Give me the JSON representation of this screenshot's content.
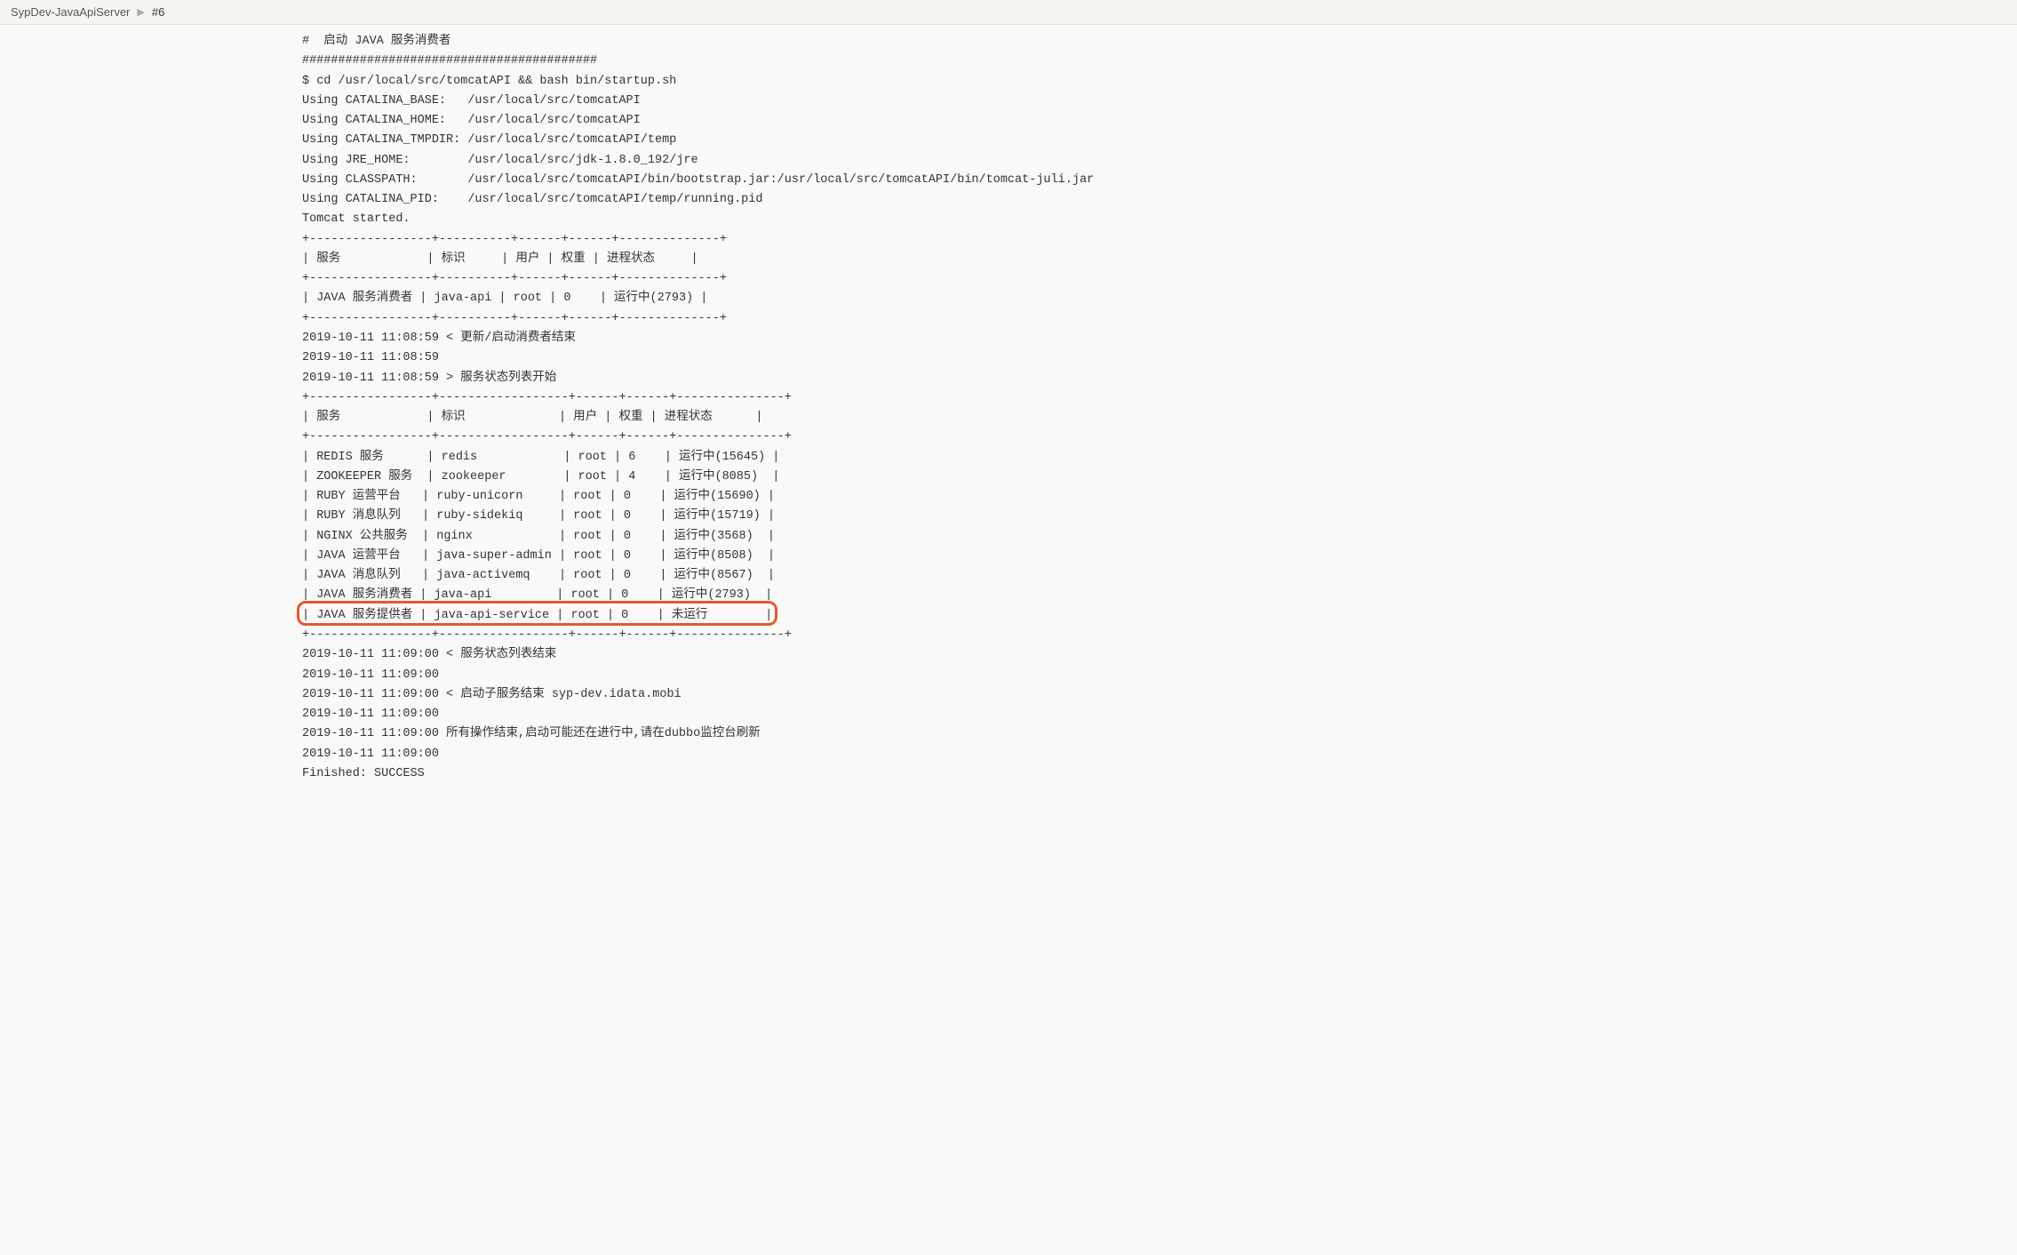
{
  "breadcrumb": {
    "project": "SypDev-JavaApiServer",
    "build": "#6"
  },
  "console": {
    "lines": [
      "#  启动 JAVA 服务消费者",
      "#########################################",
      "$ cd /usr/local/src/tomcatAPI && bash bin/startup.sh",
      "Using CATALINA_BASE:   /usr/local/src/tomcatAPI",
      "Using CATALINA_HOME:   /usr/local/src/tomcatAPI",
      "Using CATALINA_TMPDIR: /usr/local/src/tomcatAPI/temp",
      "Using JRE_HOME:        /usr/local/src/jdk-1.8.0_192/jre",
      "Using CLASSPATH:       /usr/local/src/tomcatAPI/bin/bootstrap.jar:/usr/local/src/tomcatAPI/bin/tomcat-juli.jar",
      "Using CATALINA_PID:    /usr/local/src/tomcatAPI/temp/running.pid",
      "Tomcat started.",
      "+-----------------+----------+------+------+--------------+",
      "| 服务            | 标识     | 用户 | 权重 | 进程状态     |",
      "+-----------------+----------+------+------+--------------+",
      "| JAVA 服务消费者 | java-api | root | 0    | 运行中(2793) |",
      "+-----------------+----------+------+------+--------------+",
      "2019-10-11 11:08:59 < 更新/启动消费者结束",
      "2019-10-11 11:08:59",
      "2019-10-11 11:08:59 > 服务状态列表开始",
      "+-----------------+------------------+------+------+---------------+",
      "| 服务            | 标识             | 用户 | 权重 | 进程状态      |",
      "+-----------------+------------------+------+------+---------------+",
      "| REDIS 服务      | redis            | root | 6    | 运行中(15645) |",
      "| ZOOKEEPER 服务  | zookeeper        | root | 4    | 运行中(8085)  |",
      "| RUBY 运营平台   | ruby-unicorn     | root | 0    | 运行中(15690) |",
      "| RUBY 消息队列   | ruby-sidekiq     | root | 0    | 运行中(15719) |",
      "| NGINX 公共服务  | nginx            | root | 0    | 运行中(3568)  |",
      "| JAVA 运营平台   | java-super-admin | root | 0    | 运行中(8508)  |",
      "| JAVA 消息队列   | java-activemq    | root | 0    | 运行中(8567)  |",
      "| JAVA 服务消费者 | java-api         | root | 0    | 运行中(2793)  |",
      "| JAVA 服务提供者 | java-api-service | root | 0    | 未运行        |",
      "+-----------------+------------------+------+------+---------------+",
      "2019-10-11 11:09:00 < 服务状态列表结束",
      "2019-10-11 11:09:00",
      "2019-10-11 11:09:00 < 启动子服务结束 syp-dev.idata.mobi",
      "2019-10-11 11:09:00",
      "2019-10-11 11:09:00 所有操作结束,启动可能还在进行中,请在dubbo监控台刷新",
      "2019-10-11 11:09:00",
      "Finished: SUCCESS"
    ],
    "highlight": {
      "lineIndex": 29
    }
  }
}
